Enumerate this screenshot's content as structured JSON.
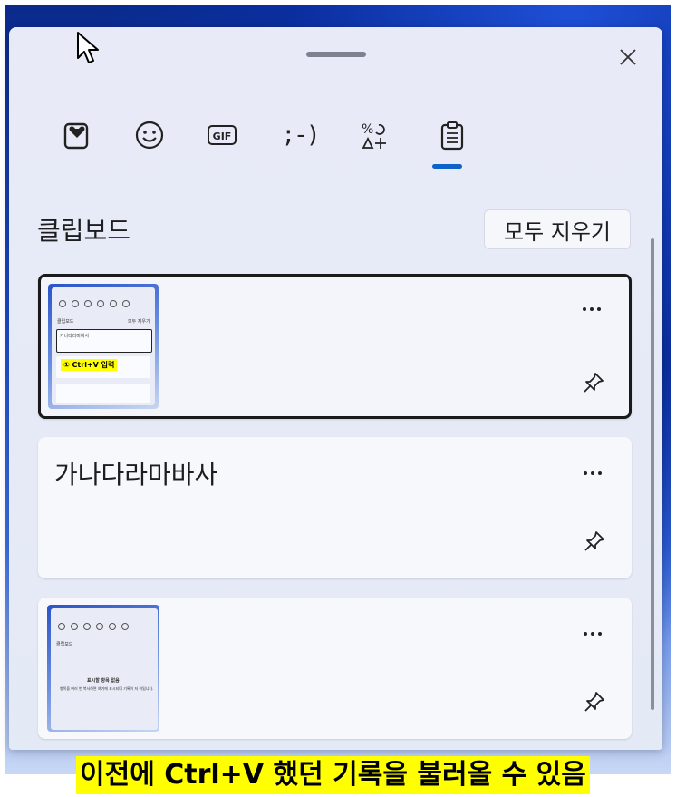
{
  "panel": {
    "title": "클립보드",
    "clear_all_label": "모두 지우기",
    "tabs": [
      {
        "icon": "heart-clipboard-icon",
        "label": ""
      },
      {
        "icon": "emoji-icon",
        "label": ""
      },
      {
        "icon": "gif-icon",
        "label": "GIF"
      },
      {
        "icon": "kaomoji-icon",
        "label": ";-)"
      },
      {
        "icon": "symbols-icon",
        "label": ""
      },
      {
        "icon": "clipboard-icon",
        "label": "",
        "active": true
      }
    ]
  },
  "items": [
    {
      "type": "image",
      "selected": true,
      "thumb": {
        "title": "클립보드",
        "clear": "모두 지우기",
        "entry": "가나다라마바사",
        "highlight": "① Ctrl+V 입력"
      }
    },
    {
      "type": "text",
      "text": "가나다라마바사"
    },
    {
      "type": "image",
      "thumb": {
        "title": "클립보드",
        "heading": "표시할 항목 없음",
        "body": "항목을 여러 번 복사하면 여기에 표시되며 기록이 저 이됩니다."
      }
    }
  ],
  "caption": "이전에 Ctrl+V 했던 기록을 불러올 수 있음",
  "colors": {
    "accent": "#0d63c8",
    "highlight": "#ffff00"
  }
}
